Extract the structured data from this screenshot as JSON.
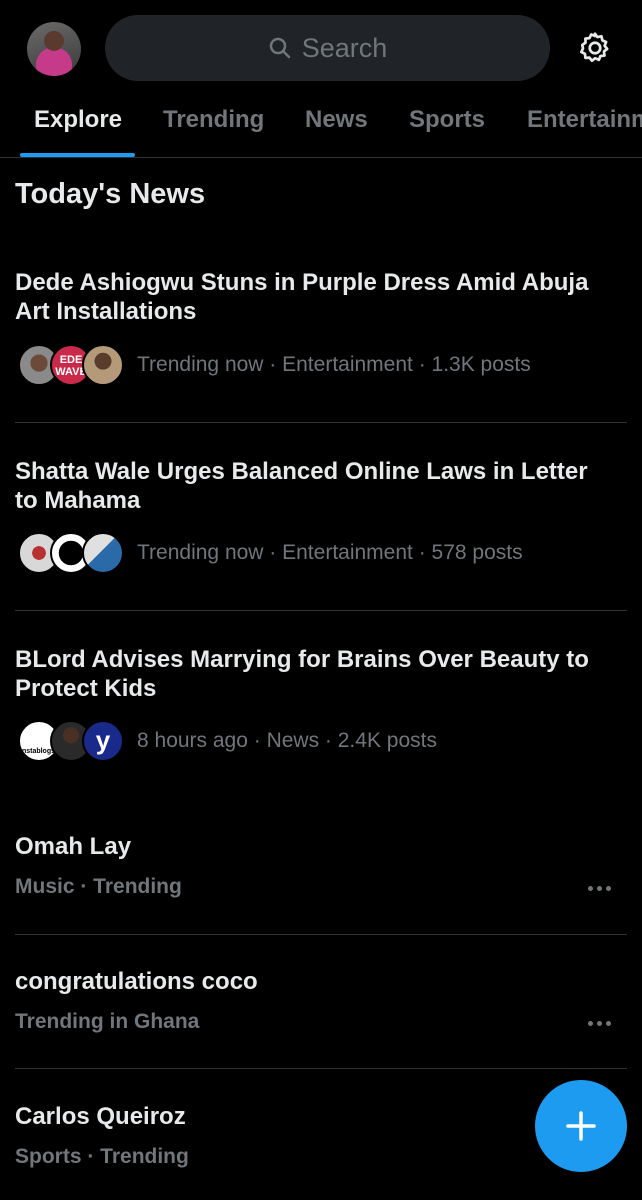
{
  "header": {
    "search_placeholder": "Search"
  },
  "tabs": [
    {
      "label": "Explore",
      "active": true
    },
    {
      "label": "Trending",
      "active": false
    },
    {
      "label": "News",
      "active": false
    },
    {
      "label": "Sports",
      "active": false
    },
    {
      "label": "Entertainment",
      "active": false
    }
  ],
  "section": {
    "title": "Today's News"
  },
  "news": [
    {
      "headline": "Dede Ashiogwu Stuns in Purple Dress Amid Abuja Art Installations",
      "meta": "Trending now · Entertainment · 1.3K posts",
      "face_texts": [
        "",
        "EDE\nWAVE",
        ""
      ]
    },
    {
      "headline": "Shatta Wale Urges Balanced Online Laws in Letter to Mahama",
      "meta": "Trending now · Entertainment · 578 posts"
    },
    {
      "headline": "BLord Advises Marrying for Brains Over Beauty to Protect Kids",
      "meta": "8 hours ago · News · 2.4K posts",
      "face_label": "instablog9ja",
      "face_letter": "y"
    }
  ],
  "trends": [
    {
      "title": "Omah Lay",
      "subtitle": "Music · Trending"
    },
    {
      "title": "congratulations coco",
      "subtitle": "Trending in Ghana"
    },
    {
      "title": "Carlos Queiroz",
      "subtitle": "Sports · Trending"
    }
  ],
  "colors": {
    "accent": "#1d9bf0",
    "background": "#000000",
    "text_primary": "#e7e9ea",
    "text_secondary": "#71767b"
  },
  "icons": {
    "search": "search-icon",
    "settings": "gear-icon",
    "more": "more-icon",
    "compose": "plus-icon"
  }
}
